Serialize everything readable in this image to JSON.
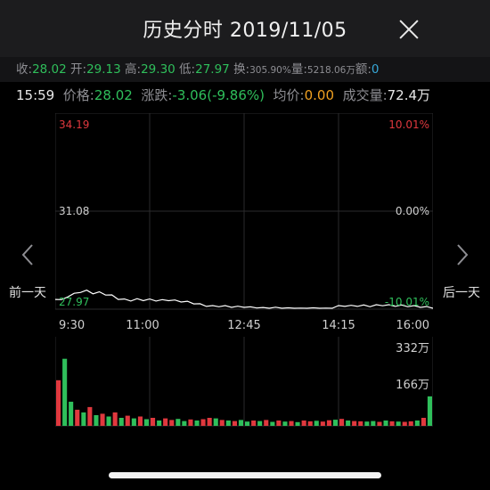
{
  "header": {
    "title": "历史分时 2019/11/05"
  },
  "summary": {
    "close_label": "收:",
    "close_value": "28.02",
    "open_label": "开:",
    "open_value": "29.13",
    "high_label": "高:",
    "high_value": "29.30",
    "low_label": "低:",
    "low_value": "27.97",
    "turnover_label": "换:",
    "turnover_value": "305.90%",
    "volume_label": "量:",
    "volume_value": "5218.06万",
    "amount_label": "额:",
    "amount_value": "0"
  },
  "detail": {
    "time": "15:59",
    "price_label": "价格:",
    "price_value": "28.02",
    "change_label": "涨跌:",
    "change_value": "-3.06(-9.86%)",
    "avg_label": "均价:",
    "avg_value": "0.00",
    "vol_label": "成交量:",
    "vol_value": "72.4万"
  },
  "nav": {
    "prev_label": "前一天",
    "next_label": "后一天"
  },
  "colors": {
    "up": "#e0383e",
    "down": "#2fbf5b",
    "line": "#ffffff",
    "grid": "#2a2a2c",
    "axis_text": "#cfcfcf"
  },
  "chart_data": [
    {
      "type": "line",
      "y_tick_labels": {
        "top": "34.19",
        "mid": "31.08",
        "bottom": "27.97"
      },
      "pct_tick_labels": {
        "top": "10.01%",
        "mid": "0.00%",
        "bottom": "-10.01%"
      },
      "x_tick_labels": [
        "9:30",
        "11:00",
        "12:45",
        "14:15",
        "16:00"
      ],
      "ylim": [
        27.97,
        34.19
      ],
      "grid": true,
      "series": [
        {
          "values": [
            28.3,
            28.25,
            28.38,
            28.45,
            28.52,
            28.55,
            28.48,
            28.5,
            28.44,
            28.4,
            28.3,
            28.27,
            28.25,
            28.28,
            28.26,
            28.27,
            28.25,
            28.25,
            28.26,
            28.24,
            28.22,
            28.2,
            28.16,
            28.12,
            28.08,
            28.06,
            28.07,
            28.06,
            28.05,
            28.04,
            28.05,
            28.02,
            28.03,
            28.0,
            28.02,
            28.01,
            28.0,
            27.99,
            28.0,
            27.98,
            27.99,
            27.99,
            27.97,
            27.98,
            28.0,
            28.06,
            28.08,
            28.07,
            28.08,
            28.08,
            28.07,
            28.09,
            28.1,
            28.09,
            28.08,
            28.08,
            28.07,
            28.06,
            28.05,
            28.03,
            28.02
          ]
        }
      ]
    },
    {
      "type": "bar",
      "y_tick_labels": [
        "332万",
        "166万"
      ],
      "ylim": [
        0,
        3320000
      ],
      "values": [
        1700000,
        2500000,
        900000,
        600000,
        500000,
        700000,
        400000,
        450000,
        350000,
        500000,
        300000,
        380000,
        280000,
        350000,
        250000,
        300000,
        200000,
        280000,
        220000,
        260000,
        180000,
        240000,
        200000,
        250000,
        300000,
        280000,
        220000,
        200000,
        180000,
        220000,
        160000,
        200000,
        180000,
        220000,
        150000,
        200000,
        160000,
        180000,
        140000,
        200000,
        170000,
        190000,
        160000,
        210000,
        230000,
        260000,
        200000,
        180000,
        170000,
        160000,
        180000,
        150000,
        200000,
        170000,
        160000,
        150000,
        170000,
        200000,
        300000,
        1100000
      ],
      "directions": [
        "up",
        "down",
        "down",
        "up",
        "down",
        "up",
        "down",
        "up",
        "down",
        "up",
        "down",
        "up",
        "down",
        "up",
        "down",
        "up",
        "down",
        "up",
        "up",
        "down",
        "down",
        "up",
        "down",
        "up",
        "up",
        "down",
        "up",
        "down",
        "up",
        "down",
        "down",
        "up",
        "down",
        "up",
        "down",
        "up",
        "down",
        "up",
        "down",
        "up",
        "up",
        "down",
        "up",
        "up",
        "down",
        "up",
        "down",
        "up",
        "up",
        "down",
        "down",
        "up",
        "down",
        "up",
        "down",
        "up",
        "up",
        "down",
        "up",
        "down"
      ]
    }
  ]
}
